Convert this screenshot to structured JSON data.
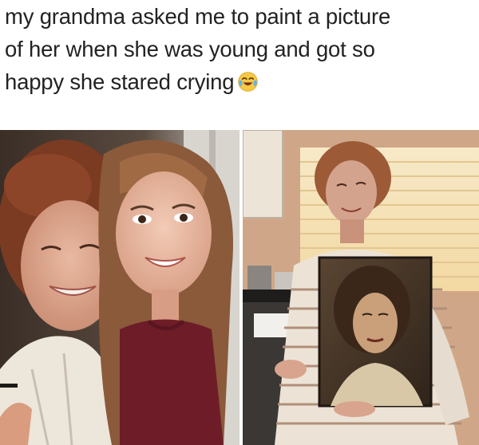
{
  "caption": {
    "line1": "my grandma asked me to paint a picture",
    "line2": "of her when she was young and got so",
    "line3": "happy she stared crying",
    "emoji": "tears-of-joy-emoji"
  },
  "photos": {
    "left": {
      "subject": "grandma-granddaughter-selfie"
    },
    "right": {
      "subject": "grandma-holding-portrait-painting"
    }
  }
}
